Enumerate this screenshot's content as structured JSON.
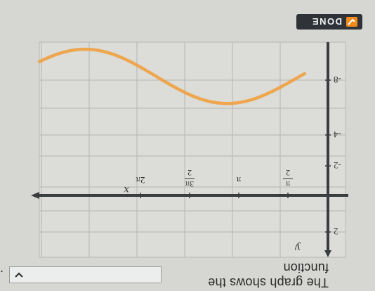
{
  "button": {
    "done_label": "DONE"
  },
  "prompt": {
    "text": "The graph shows the function",
    "dropdown_value": "",
    "period": "."
  },
  "graph": {
    "x_label": "x",
    "y_label": "y",
    "x_ticks": [
      {
        "num": "π",
        "den": "2"
      },
      {
        "text": "π"
      },
      {
        "num": "3π",
        "den": "2"
      },
      {
        "text": "2π"
      }
    ],
    "y_ticks": [
      "2",
      "-2",
      "-4",
      "-8"
    ],
    "curve_color": "#f0a040",
    "axis_color": "#3a3d40"
  }
}
